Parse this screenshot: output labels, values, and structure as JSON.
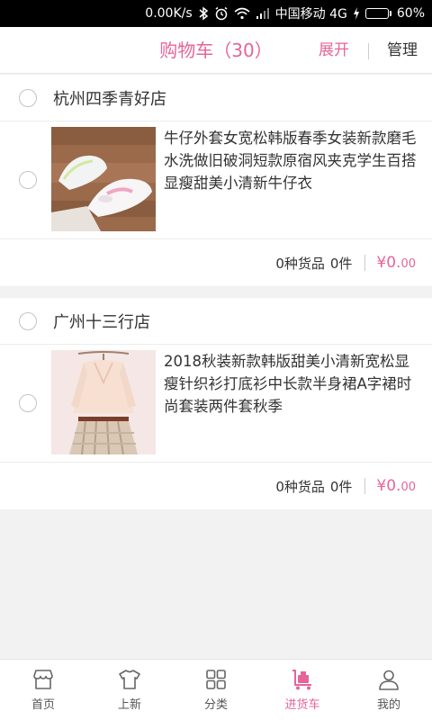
{
  "status_bar": {
    "speed": "0.00K/s",
    "carrier": "中国移动 4G",
    "battery": "60%",
    "battery_level": 0.6
  },
  "header": {
    "title": "购物车（30）",
    "expand_label": "展开",
    "manage_label": "管理"
  },
  "shops": [
    {
      "name": "杭州四季青好店",
      "item": {
        "title": "牛仔外套女宽松韩版春季女装新款磨毛水洗做旧破洞短款原宿风夹克学生百搭显瘦甜美小清新牛仔衣"
      },
      "summary": {
        "kinds": "0种货品",
        "count": "0件",
        "price_int": "¥0.",
        "price_dec": "00"
      }
    },
    {
      "name": "广州十三行店",
      "item": {
        "title": "2018秋装新款韩版甜美小清新宽松显瘦针织衫打底衫中长款半身裙A字裙时尚套装两件套秋季"
      },
      "summary": {
        "kinds": "0种货品",
        "count": "0件",
        "price_int": "¥0.",
        "price_dec": "00"
      }
    }
  ],
  "tabbar": {
    "tabs": [
      {
        "label": "首页",
        "icon": "store-icon"
      },
      {
        "label": "上新",
        "icon": "tshirt-icon"
      },
      {
        "label": "分类",
        "icon": "grid-icon"
      },
      {
        "label": "进货车",
        "icon": "cart-icon"
      },
      {
        "label": "我的",
        "icon": "person-icon"
      }
    ],
    "active_index": 3
  },
  "colors": {
    "accent": "#e5659a",
    "battery": "#3bd23b"
  }
}
